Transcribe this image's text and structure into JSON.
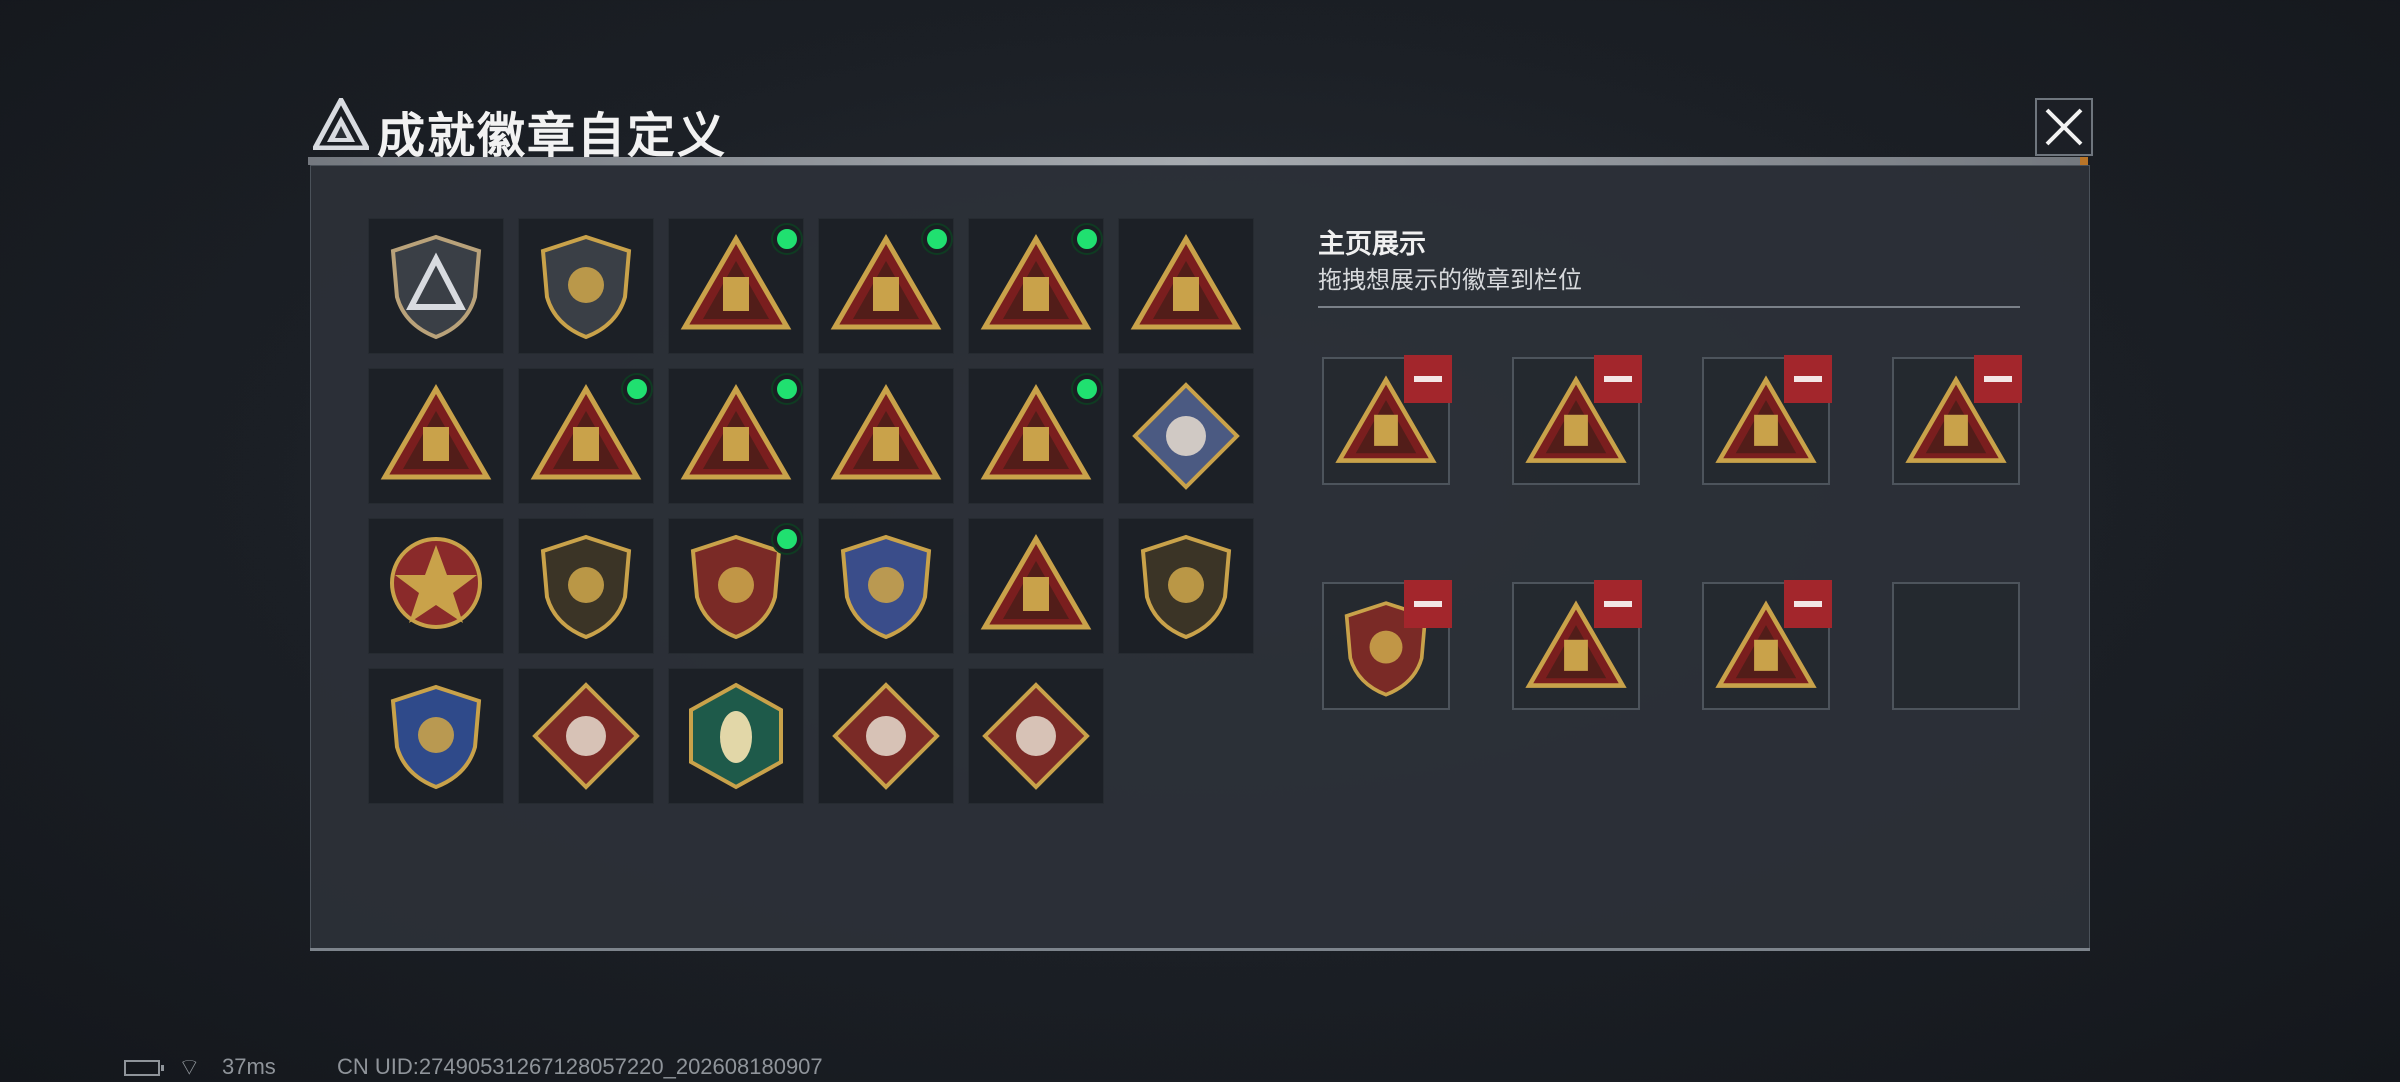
{
  "header": {
    "title": "成就徽章自定义",
    "logo_icon": "triangle-a-logo-icon",
    "close_icon": "close-x-icon"
  },
  "badges": [
    {
      "icon": "shield-delta-badge-icon",
      "new": false
    },
    {
      "icon": "helicopter-shield-badge-icon",
      "new": false
    },
    {
      "icon": "s7-tower-badge-icon",
      "new": true
    },
    {
      "icon": "s8-tower-badge-icon",
      "new": true
    },
    {
      "icon": "s9-cannon-badge-icon",
      "new": true
    },
    {
      "icon": "golden-egg-badge-icon",
      "new": false
    },
    {
      "icon": "number-one-badge-icon",
      "new": false
    },
    {
      "icon": "usb-drive-badge-icon",
      "new": true
    },
    {
      "icon": "hands-diamond-badge-icon",
      "new": true
    },
    {
      "icon": "soldiers-badge-icon",
      "new": false
    },
    {
      "icon": "koi-fish-badge-icon",
      "new": true
    },
    {
      "icon": "rose-diamond-badge-icon",
      "new": false
    },
    {
      "icon": "star-compass-badge-icon",
      "new": false
    },
    {
      "icon": "chevron-shield-badge-icon",
      "new": false
    },
    {
      "icon": "ribbon-shield-badge-icon",
      "new": true
    },
    {
      "icon": "crystal-shield-badge-icon",
      "new": false
    },
    {
      "icon": "rifle-target-badge-icon",
      "new": false
    },
    {
      "icon": "gun-shield-badge-icon",
      "new": false
    },
    {
      "icon": "crossed-shield-badge-icon",
      "new": false
    },
    {
      "icon": "wolf-diamond-badge-icon",
      "new": false
    },
    {
      "icon": "wasp-hexagon-badge-icon",
      "new": false
    },
    {
      "icon": "dragon-diamond-badge-icon",
      "new": false
    },
    {
      "icon": "runner-diamond-badge-icon",
      "new": false
    }
  ],
  "showcase": {
    "title": "主页展示",
    "subtitle": "拖拽想展示的徽章到栏位",
    "slots": [
      {
        "icon": "s9-cannon-badge-icon",
        "filled": true
      },
      {
        "icon": "hands-diamond-badge-icon",
        "filled": true
      },
      {
        "icon": "usb-drive-badge-icon",
        "filled": true
      },
      {
        "icon": "koi-fish-badge-icon",
        "filled": true
      },
      {
        "icon": "ribbon-shield-badge-icon",
        "filled": true
      },
      {
        "icon": "s7-tower-badge-icon",
        "filled": true
      },
      {
        "icon": "s8-tower-badge-icon",
        "filled": true
      },
      {
        "icon": "empty-slot",
        "filled": false
      }
    ],
    "remove_icon": "minus-icon"
  },
  "status_bar": {
    "battery_icon": "battery-charging-icon",
    "wifi_icon": "wifi-icon",
    "ping": "37ms",
    "uid": "CN UID:2749053126712805​7220_202608180907"
  },
  "colors": {
    "panel": "#2c3138",
    "cell": "#1c2026",
    "gold": "#c9a24a",
    "red": "#7a1e1e",
    "green": "#20e070",
    "remove": "#a3262c"
  }
}
